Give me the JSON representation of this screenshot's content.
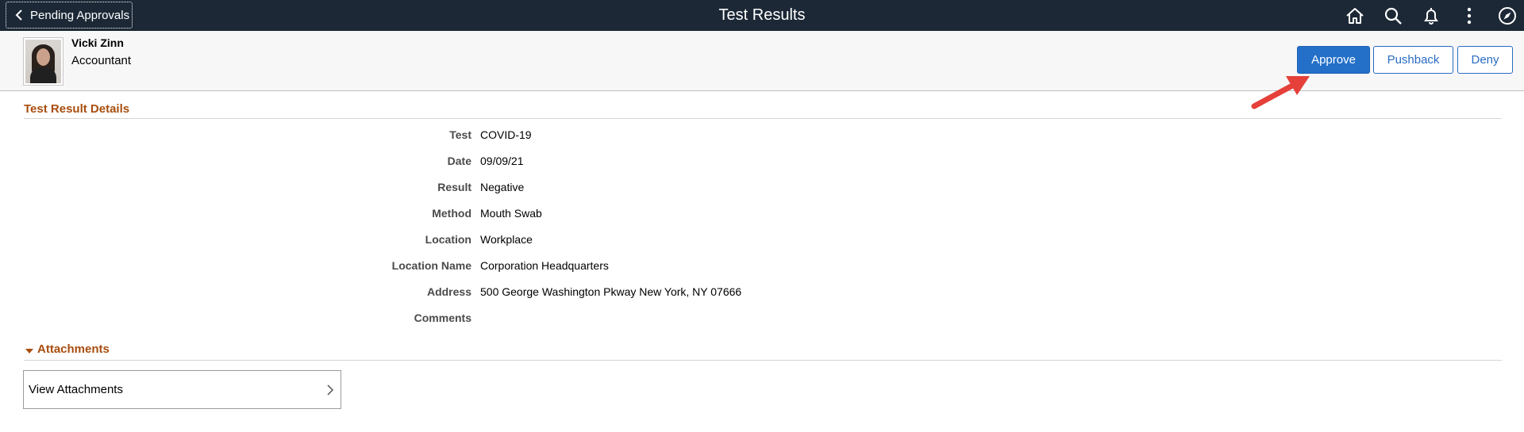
{
  "banner": {
    "back_label": "Pending Approvals",
    "title": "Test Results",
    "icons": [
      "home-icon",
      "search-icon",
      "bell-icon",
      "more-vertical-icon",
      "navbar-compass-icon"
    ],
    "background": "#1c2836"
  },
  "person": {
    "name": "Vicki Zinn",
    "title": "Accountant"
  },
  "actions": {
    "approve": "Approve",
    "pushback": "Pushback",
    "deny": "Deny",
    "primary_color": "#2470c9"
  },
  "details": {
    "section_title": "Test Result Details",
    "rows": [
      {
        "label": "Test",
        "value": "COVID-19"
      },
      {
        "label": "Date",
        "value": "09/09/21"
      },
      {
        "label": "Result",
        "value": "Negative"
      },
      {
        "label": "Method",
        "value": "Mouth Swab"
      },
      {
        "label": "Location",
        "value": "Workplace"
      },
      {
        "label": "Location Name",
        "value": "Corporation Headquarters"
      },
      {
        "label": "Address",
        "value": "500 George Washington Pkway New York, NY 07666"
      },
      {
        "label": "Comments",
        "value": ""
      }
    ]
  },
  "attachments": {
    "section_title": "Attachments",
    "view_label": "View Attachments"
  },
  "colors": {
    "section_title": "#a84d0e",
    "annotation_arrow": "#e5403a"
  }
}
